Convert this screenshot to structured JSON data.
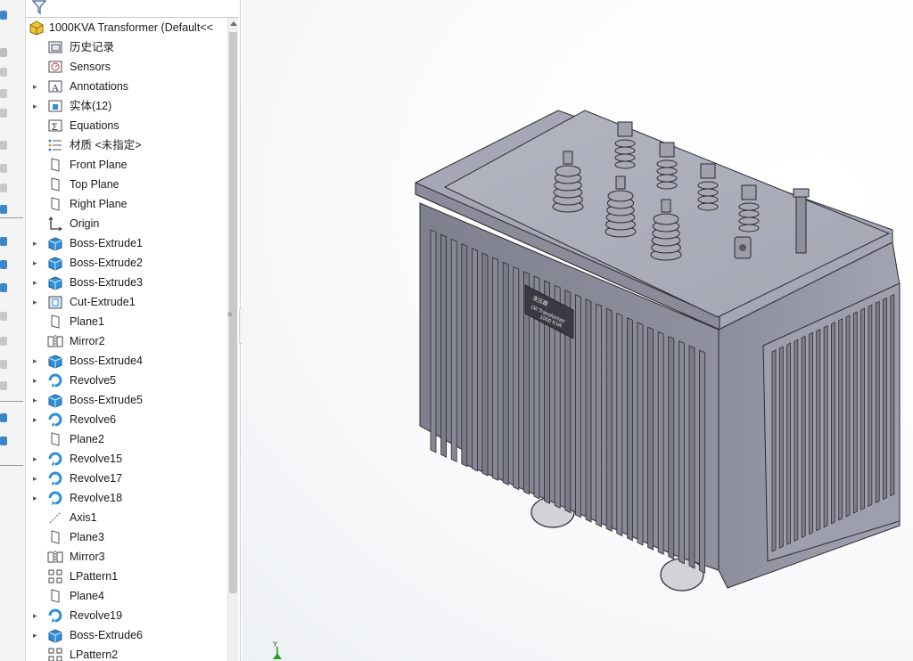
{
  "tree": {
    "root": "1000KVA Transformer  (Default<<",
    "items": [
      {
        "label": "历史记录",
        "icon": "history-folder-icon",
        "expandable": false
      },
      {
        "label": "Sensors",
        "icon": "sensors-icon",
        "expandable": false
      },
      {
        "label": "Annotations",
        "icon": "annotations-icon",
        "expandable": true
      },
      {
        "label": "实体(12)",
        "icon": "solid-bodies-folder-icon",
        "expandable": true
      },
      {
        "label": "Equations",
        "icon": "equations-icon",
        "expandable": false
      },
      {
        "label": "材质 <未指定>",
        "icon": "material-icon",
        "expandable": false
      },
      {
        "label": "Front Plane",
        "icon": "plane-icon",
        "expandable": false
      },
      {
        "label": "Top Plane",
        "icon": "plane-icon",
        "expandable": false
      },
      {
        "label": "Right Plane",
        "icon": "plane-icon",
        "expandable": false
      },
      {
        "label": "Origin",
        "icon": "origin-icon",
        "expandable": false
      },
      {
        "label": "Boss-Extrude1",
        "icon": "boss-extrude-icon",
        "expandable": true
      },
      {
        "label": "Boss-Extrude2",
        "icon": "boss-extrude-icon",
        "expandable": true
      },
      {
        "label": "Boss-Extrude3",
        "icon": "boss-extrude-icon",
        "expandable": true
      },
      {
        "label": "Cut-Extrude1",
        "icon": "cut-extrude-icon",
        "expandable": true
      },
      {
        "label": "Plane1",
        "icon": "plane-icon",
        "expandable": false
      },
      {
        "label": "Mirror2",
        "icon": "mirror-icon",
        "expandable": false
      },
      {
        "label": "Boss-Extrude4",
        "icon": "boss-extrude-icon",
        "expandable": true
      },
      {
        "label": "Revolve5",
        "icon": "revolve-icon",
        "expandable": true
      },
      {
        "label": "Boss-Extrude5",
        "icon": "boss-extrude-icon",
        "expandable": true
      },
      {
        "label": "Revolve6",
        "icon": "revolve-icon",
        "expandable": true
      },
      {
        "label": "Plane2",
        "icon": "plane-icon",
        "expandable": false
      },
      {
        "label": "Revolve15",
        "icon": "revolve-icon",
        "expandable": true
      },
      {
        "label": "Revolve17",
        "icon": "revolve-icon",
        "expandable": true
      },
      {
        "label": "Revolve18",
        "icon": "revolve-icon",
        "expandable": true
      },
      {
        "label": "Axis1",
        "icon": "axis-icon",
        "expandable": false
      },
      {
        "label": "Plane3",
        "icon": "plane-icon",
        "expandable": false
      },
      {
        "label": "Mirror3",
        "icon": "mirror-icon",
        "expandable": false
      },
      {
        "label": "LPattern1",
        "icon": "linear-pattern-icon",
        "expandable": false
      },
      {
        "label": "Plane4",
        "icon": "plane-icon",
        "expandable": false
      },
      {
        "label": "Revolve19",
        "icon": "revolve-icon",
        "expandable": true
      },
      {
        "label": "Boss-Extrude6",
        "icon": "boss-extrude-icon",
        "expandable": true
      },
      {
        "label": "LPattern2",
        "icon": "linear-pattern-icon",
        "expandable": false
      }
    ]
  },
  "viewport": {
    "nameplate": [
      "变压器",
      "Oil Transformer",
      "1000 KVA"
    ],
    "triad_axis": "Y"
  },
  "colors": {
    "feature_blue": "#2f8fd8",
    "model_face_top": "#a9abb8",
    "model_face_left": "#8a8c99",
    "model_face_right": "#9c9eab"
  }
}
